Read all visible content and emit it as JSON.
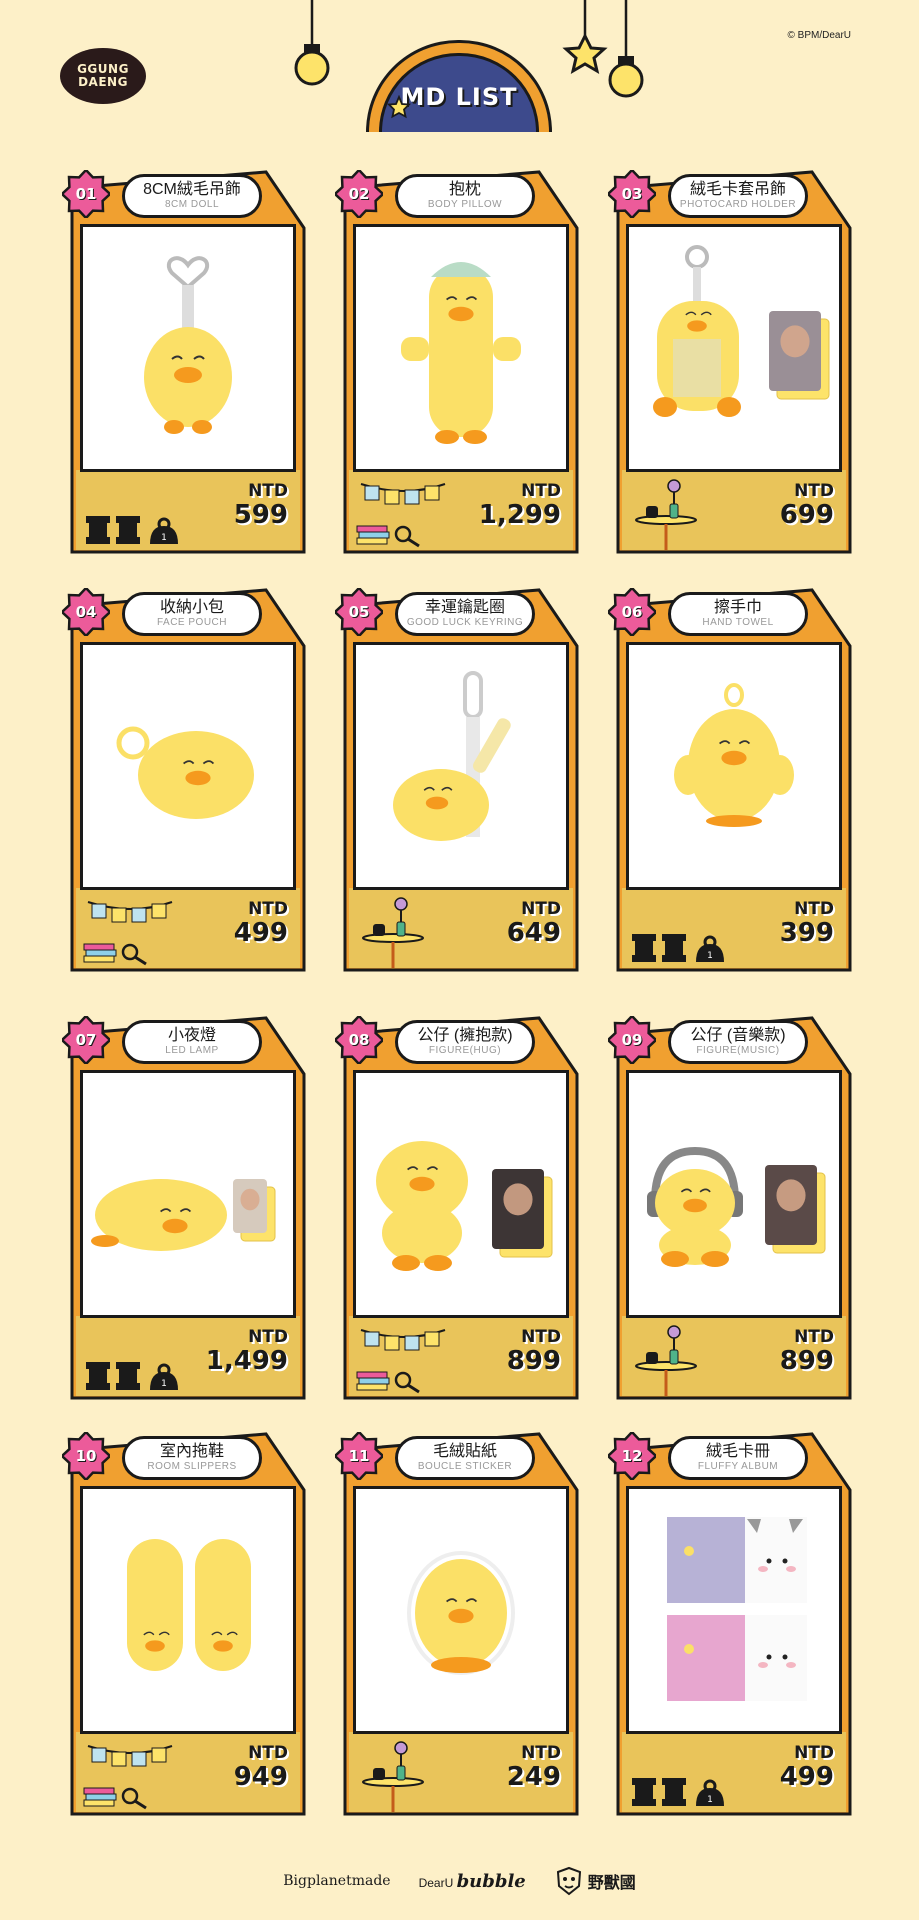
{
  "copyright": "© BPM/DearU",
  "logo": {
    "line1": "GGUNG",
    "line2": "DAENG"
  },
  "title": "MD LIST",
  "colors": {
    "background": "#fdf0c8",
    "frame": "#f0a030",
    "panel": "#e9c45a",
    "badge": "#ec5b9a",
    "duck": "#fbe067",
    "beak": "#f59a1e",
    "navy": "#3d4a8c"
  },
  "currency": "NTD",
  "products": [
    {
      "num": "01",
      "zh": "8CM絨毛吊飾",
      "en": "8CM DOLL",
      "price": "599",
      "item": "keychain-doll",
      "props": "weights"
    },
    {
      "num": "02",
      "zh": "抱枕",
      "en": "BODY PILLOW",
      "price": "1,299",
      "item": "body-pillow",
      "props": "banner"
    },
    {
      "num": "03",
      "zh": "絨毛卡套吊飾",
      "en": "PHOTOCARD HOLDER",
      "price": "699",
      "item": "card-holder",
      "props": "table"
    },
    {
      "num": "04",
      "zh": "收納小包",
      "en": "FACE POUCH",
      "price": "499",
      "item": "pouch",
      "props": "banner"
    },
    {
      "num": "05",
      "zh": "幸運鑰匙圈",
      "en": "GOOD LUCK KEYRING",
      "price": "649",
      "item": "keyring",
      "props": "table"
    },
    {
      "num": "06",
      "zh": "擦手巾",
      "en": "HAND TOWEL",
      "price": "399",
      "item": "towel",
      "props": "weights"
    },
    {
      "num": "07",
      "zh": "小夜燈",
      "en": "LED LAMP",
      "price": "1,499",
      "item": "lamp",
      "props": "weights"
    },
    {
      "num": "08",
      "zh": "公仔 (擁抱款)",
      "en": "FIGURE(HUG)",
      "price": "899",
      "item": "figure-hug",
      "props": "banner"
    },
    {
      "num": "09",
      "zh": "公仔 (音樂款)",
      "en": "FIGURE(MUSIC)",
      "price": "899",
      "item": "figure-music",
      "props": "table"
    },
    {
      "num": "10",
      "zh": "室內拖鞋",
      "en": "ROOM SLIPPERS",
      "price": "949",
      "item": "slippers",
      "props": "banner"
    },
    {
      "num": "11",
      "zh": "毛絨貼紙",
      "en": "BOUCLE STICKER",
      "price": "249",
      "item": "sticker",
      "props": "table"
    },
    {
      "num": "12",
      "zh": "絨毛卡冊",
      "en": "FLUFFY ALBUM",
      "price": "499",
      "item": "album",
      "props": "weights"
    }
  ],
  "footer": {
    "bigplanet": "Bigplanetmade",
    "dearu": "DearU",
    "bubble": "bubble",
    "yss": "野獸國"
  }
}
